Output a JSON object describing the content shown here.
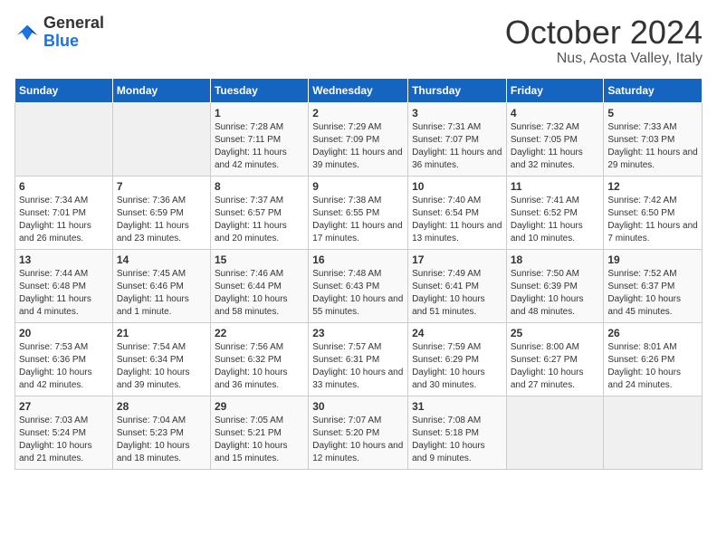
{
  "header": {
    "logo_line1": "General",
    "logo_line2": "Blue",
    "month_title": "October 2024",
    "location": "Nus, Aosta Valley, Italy"
  },
  "weekdays": [
    "Sunday",
    "Monday",
    "Tuesday",
    "Wednesday",
    "Thursday",
    "Friday",
    "Saturday"
  ],
  "weeks": [
    [
      {
        "day": "",
        "empty": true
      },
      {
        "day": "",
        "empty": true
      },
      {
        "day": "1",
        "sunrise": "7:28 AM",
        "sunset": "7:11 PM",
        "daylight": "11 hours and 42 minutes."
      },
      {
        "day": "2",
        "sunrise": "7:29 AM",
        "sunset": "7:09 PM",
        "daylight": "11 hours and 39 minutes."
      },
      {
        "day": "3",
        "sunrise": "7:31 AM",
        "sunset": "7:07 PM",
        "daylight": "11 hours and 36 minutes."
      },
      {
        "day": "4",
        "sunrise": "7:32 AM",
        "sunset": "7:05 PM",
        "daylight": "11 hours and 32 minutes."
      },
      {
        "day": "5",
        "sunrise": "7:33 AM",
        "sunset": "7:03 PM",
        "daylight": "11 hours and 29 minutes."
      }
    ],
    [
      {
        "day": "6",
        "sunrise": "7:34 AM",
        "sunset": "7:01 PM",
        "daylight": "11 hours and 26 minutes."
      },
      {
        "day": "7",
        "sunrise": "7:36 AM",
        "sunset": "6:59 PM",
        "daylight": "11 hours and 23 minutes."
      },
      {
        "day": "8",
        "sunrise": "7:37 AM",
        "sunset": "6:57 PM",
        "daylight": "11 hours and 20 minutes."
      },
      {
        "day": "9",
        "sunrise": "7:38 AM",
        "sunset": "6:55 PM",
        "daylight": "11 hours and 17 minutes."
      },
      {
        "day": "10",
        "sunrise": "7:40 AM",
        "sunset": "6:54 PM",
        "daylight": "11 hours and 13 minutes."
      },
      {
        "day": "11",
        "sunrise": "7:41 AM",
        "sunset": "6:52 PM",
        "daylight": "11 hours and 10 minutes."
      },
      {
        "day": "12",
        "sunrise": "7:42 AM",
        "sunset": "6:50 PM",
        "daylight": "11 hours and 7 minutes."
      }
    ],
    [
      {
        "day": "13",
        "sunrise": "7:44 AM",
        "sunset": "6:48 PM",
        "daylight": "11 hours and 4 minutes."
      },
      {
        "day": "14",
        "sunrise": "7:45 AM",
        "sunset": "6:46 PM",
        "daylight": "11 hours and 1 minute."
      },
      {
        "day": "15",
        "sunrise": "7:46 AM",
        "sunset": "6:44 PM",
        "daylight": "10 hours and 58 minutes."
      },
      {
        "day": "16",
        "sunrise": "7:48 AM",
        "sunset": "6:43 PM",
        "daylight": "10 hours and 55 minutes."
      },
      {
        "day": "17",
        "sunrise": "7:49 AM",
        "sunset": "6:41 PM",
        "daylight": "10 hours and 51 minutes."
      },
      {
        "day": "18",
        "sunrise": "7:50 AM",
        "sunset": "6:39 PM",
        "daylight": "10 hours and 48 minutes."
      },
      {
        "day": "19",
        "sunrise": "7:52 AM",
        "sunset": "6:37 PM",
        "daylight": "10 hours and 45 minutes."
      }
    ],
    [
      {
        "day": "20",
        "sunrise": "7:53 AM",
        "sunset": "6:36 PM",
        "daylight": "10 hours and 42 minutes."
      },
      {
        "day": "21",
        "sunrise": "7:54 AM",
        "sunset": "6:34 PM",
        "daylight": "10 hours and 39 minutes."
      },
      {
        "day": "22",
        "sunrise": "7:56 AM",
        "sunset": "6:32 PM",
        "daylight": "10 hours and 36 minutes."
      },
      {
        "day": "23",
        "sunrise": "7:57 AM",
        "sunset": "6:31 PM",
        "daylight": "10 hours and 33 minutes."
      },
      {
        "day": "24",
        "sunrise": "7:59 AM",
        "sunset": "6:29 PM",
        "daylight": "10 hours and 30 minutes."
      },
      {
        "day": "25",
        "sunrise": "8:00 AM",
        "sunset": "6:27 PM",
        "daylight": "10 hours and 27 minutes."
      },
      {
        "day": "26",
        "sunrise": "8:01 AM",
        "sunset": "6:26 PM",
        "daylight": "10 hours and 24 minutes."
      }
    ],
    [
      {
        "day": "27",
        "sunrise": "7:03 AM",
        "sunset": "5:24 PM",
        "daylight": "10 hours and 21 minutes."
      },
      {
        "day": "28",
        "sunrise": "7:04 AM",
        "sunset": "5:23 PM",
        "daylight": "10 hours and 18 minutes."
      },
      {
        "day": "29",
        "sunrise": "7:05 AM",
        "sunset": "5:21 PM",
        "daylight": "10 hours and 15 minutes."
      },
      {
        "day": "30",
        "sunrise": "7:07 AM",
        "sunset": "5:20 PM",
        "daylight": "10 hours and 12 minutes."
      },
      {
        "day": "31",
        "sunrise": "7:08 AM",
        "sunset": "5:18 PM",
        "daylight": "10 hours and 9 minutes."
      },
      {
        "day": "",
        "empty": true
      },
      {
        "day": "",
        "empty": true
      }
    ]
  ]
}
